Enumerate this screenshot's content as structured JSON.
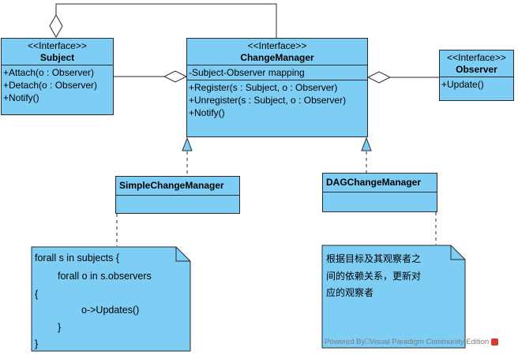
{
  "subject": {
    "stereotype": "<<Interface>>",
    "name": "Subject",
    "operations": [
      "+Attach(o : Observer)",
      "+Detach(o : Observer)",
      "+Notify()"
    ]
  },
  "change_manager": {
    "stereotype": "<<Interface>>",
    "name": "ChangeManager",
    "attributes": [
      "-Subject-Observer mapping"
    ],
    "operations": [
      "+Register(s : Subject, o : Observer)",
      "+Unregister(s : Subject, o : Observer)",
      "+Notify()"
    ]
  },
  "observer": {
    "stereotype": "<<Interface>>",
    "name": "Observer",
    "operations": [
      "+Update()"
    ]
  },
  "simple_change_manager": {
    "name": "SimpleChangeManager"
  },
  "dag_change_manager": {
    "name": "DAGChangeManager"
  },
  "note_simple": {
    "lines": [
      "forall s in subjects {",
      "forall o in s.observers",
      "{",
      "o->Updates()",
      "}",
      "}"
    ]
  },
  "note_dag": {
    "lines": [
      "根据目标及其观察者之",
      "间的依赖关系，更新对",
      "应的观察者"
    ]
  },
  "watermark": "Powered By⎕Visual Paradigm Community Edition",
  "colors": {
    "box_fill": "#7ecdf4",
    "border": "#2b2b2b"
  }
}
